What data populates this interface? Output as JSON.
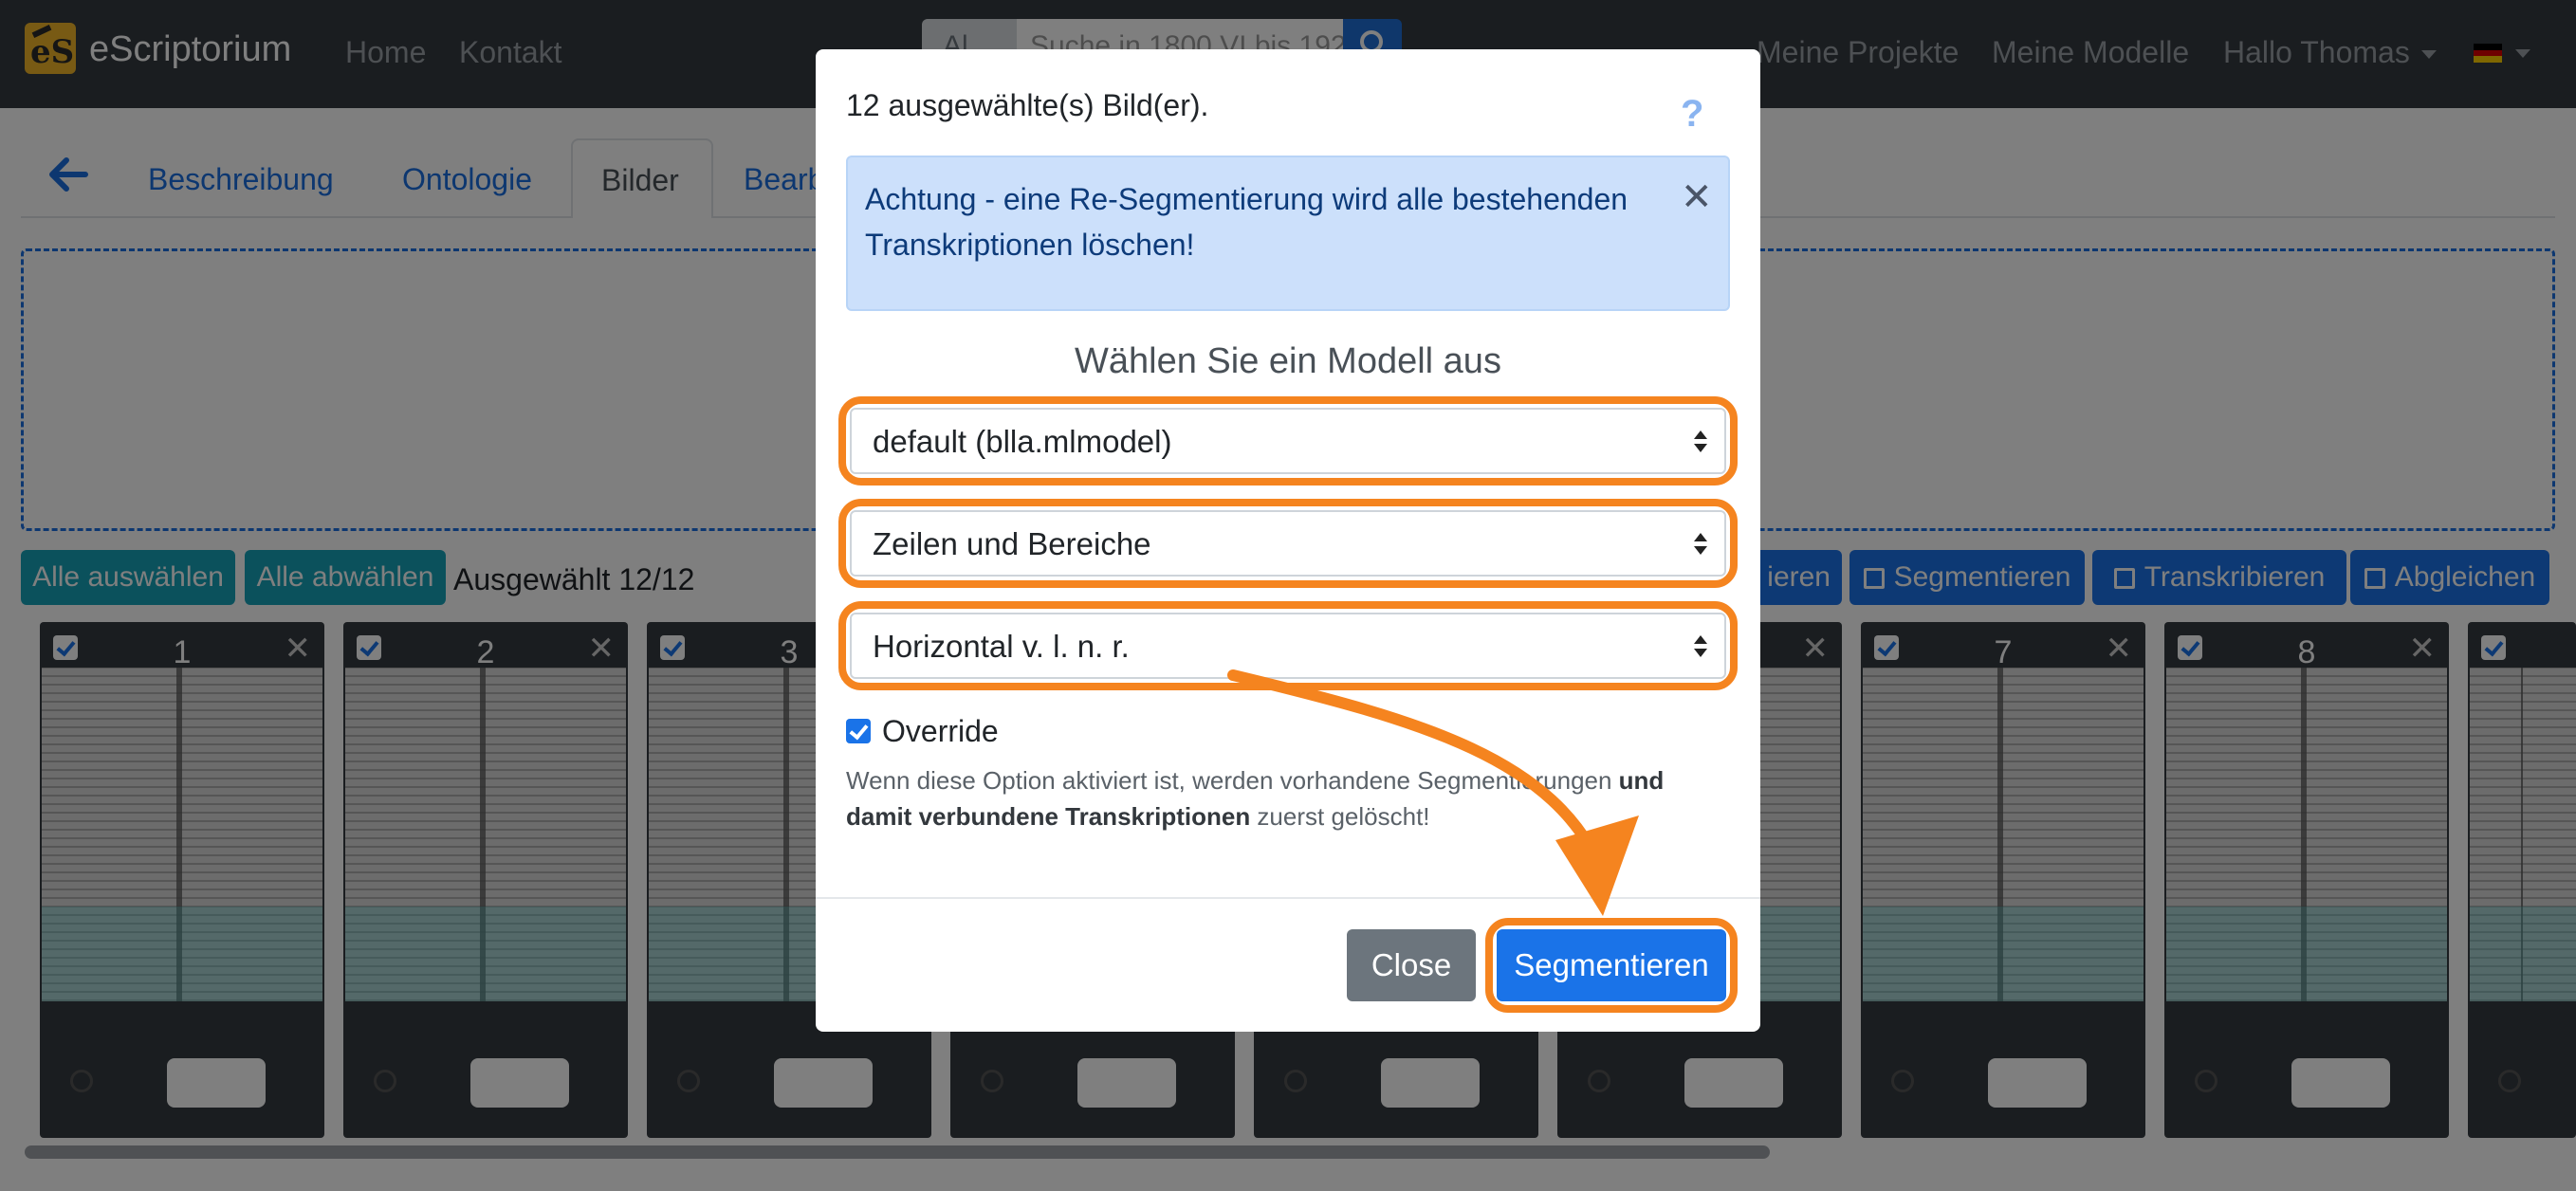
{
  "navbar": {
    "brand": "eScriptorium",
    "logo_text": "eS",
    "links": [
      "Home",
      "Kontakt"
    ],
    "search_scope": "Al",
    "search_placeholder": "Suche in 1800 VI bis 192",
    "right_links": [
      "Meine Projekte",
      "Meine Modelle"
    ],
    "user_menu": "Hallo Thomas",
    "language": "de"
  },
  "tabs": [
    "Beschreibung",
    "Ontologie",
    "Bilder",
    "Bearb"
  ],
  "active_tab": "Bilder",
  "toolbar": {
    "select_all": "Alle auswählen",
    "deselect_all": "Alle abwählen",
    "selected_count": "Ausgewählt 12/12",
    "import_partial": "ieren",
    "segment": "Segmentieren",
    "transcribe": "Transkribieren",
    "align": "Abgleichen"
  },
  "cards": [
    {
      "num": "1"
    },
    {
      "num": "2"
    },
    {
      "num": "3"
    },
    {
      "num": ""
    },
    {
      "num": ""
    },
    {
      "num": ""
    },
    {
      "num": "7"
    },
    {
      "num": "8"
    },
    {
      "num": ""
    }
  ],
  "modal": {
    "title": "12 ausgewählte(s) Bild(er).",
    "help": "?",
    "alert": "Achtung - eine Re-Segmentierung wird alle bestehenden Transkriptionen löschen!",
    "heading": "Wählen Sie ein Modell aus",
    "model_select": "default (blla.mlmodel)",
    "steps_select": "Zeilen und Bereiche",
    "direction_select": "Horizontal v. l. n. r.",
    "override_label": "Override",
    "override_checked": true,
    "help_text_1": "Wenn diese Option aktiviert ist, werden vorhandene Segmentierungen ",
    "help_text_bold": "und damit verbundene Transkriptionen",
    "help_text_2": " zuerst gelöscht!",
    "close_button": "Close",
    "submit_button": "Segmentieren"
  },
  "colors": {
    "navbar": "#343a40",
    "primary": "#1a73e8",
    "teal": "#17a2b8",
    "highlight": "#f5841f",
    "alert_bg": "#cce0fb"
  }
}
